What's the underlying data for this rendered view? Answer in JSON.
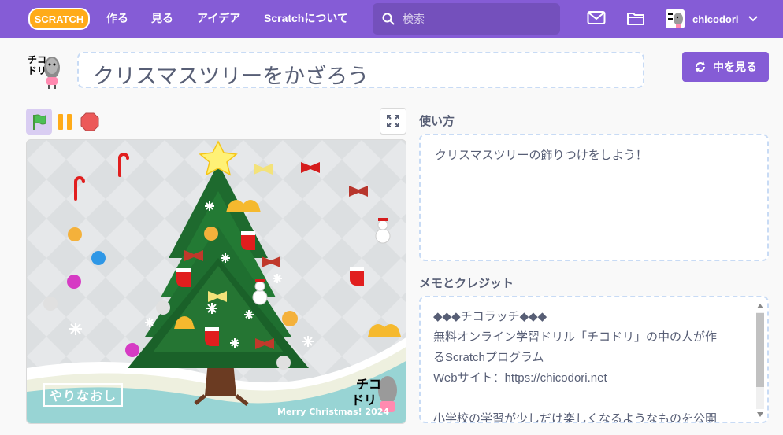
{
  "nav": {
    "logo_text": "SCRATCH",
    "links": [
      "作る",
      "見る",
      "アイデア",
      "Scratchについて"
    ],
    "search_placeholder": "検索",
    "username": "chicodori",
    "icons": [
      "messages-icon",
      "my-stuff-folder-icon",
      "chevron-down-icon"
    ]
  },
  "project": {
    "title": "クリスマスツリーをかざろう",
    "see_inside_label": "中を見る",
    "author_avatar_text": "チコドリ"
  },
  "controls": {
    "icons": [
      "green-flag-icon",
      "pause-icon",
      "stop-icon",
      "fullscreen-icon"
    ]
  },
  "stage": {
    "reset_label": "やりなおし",
    "footer_text": "Merry Christmas! 2024",
    "watermark_text": "チコドリ"
  },
  "instructions": {
    "heading": "使い方",
    "text": "クリスマスツリーの飾りつけをしよう！"
  },
  "notes": {
    "heading": "メモとクレジット",
    "lines": [
      "◆◆◆チコラッチ◆◆◆",
      "無料オンライン学習ドリル「チコドリ」の中の人が作",
      "るScratchプログラム",
      "Webサイト：https://chicodori.net",
      "",
      "小学校の学習が少しだけ楽しくなるようなものを公開"
    ]
  },
  "colors": {
    "brand_purple": "#855cd6",
    "flag_green": "#4cbf56",
    "pause_orange": "#ffab19",
    "stop_red": "#ec5959",
    "text_gray": "#575e75"
  }
}
